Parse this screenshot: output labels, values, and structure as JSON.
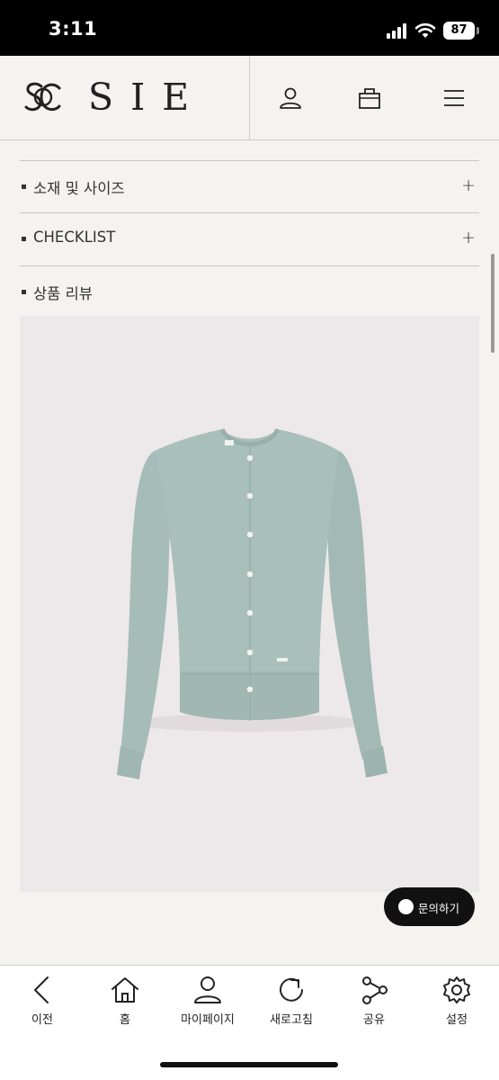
{
  "status_bar": {
    "time": "3:11",
    "battery": "87"
  },
  "header": {
    "brand": "SIE"
  },
  "accordion": [
    {
      "label": "소재 및 사이즈",
      "expand": "+"
    },
    {
      "label": "CHECKLIST",
      "expand": "+"
    }
  ],
  "review": {
    "label": "상품 리뷰"
  },
  "product_image": {
    "description": "mint-green-knit-cardigan"
  },
  "inquiry": {
    "label": "문의하기"
  },
  "bottom_nav": {
    "items": [
      {
        "label": "이전",
        "icon": "back-icon"
      },
      {
        "label": "홈",
        "icon": "home-icon"
      },
      {
        "label": "마이페이지",
        "icon": "user-icon"
      },
      {
        "label": "새로고침",
        "icon": "refresh-icon"
      },
      {
        "label": "공유",
        "icon": "share-icon"
      },
      {
        "label": "설정",
        "icon": "gear-icon"
      }
    ]
  },
  "colors": {
    "background": "#f5f3ef",
    "cardigan": "#a7bdb9",
    "photo_bg": "#ede8e9",
    "button": "#111111"
  }
}
